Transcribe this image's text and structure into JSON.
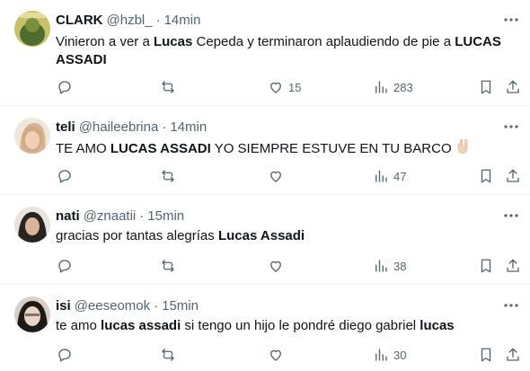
{
  "tweets": [
    {
      "name": "CLARK",
      "handle": "@hzbl_",
      "dot": "·",
      "time": "14min",
      "text": [
        {
          "t": "Vinieron a ver a "
        },
        {
          "t": "Lucas",
          "b": true
        },
        {
          "t": " Cepeda y terminaron aplaudiendo de pie a "
        },
        {
          "t": "LUCAS ASSADI",
          "b": true
        }
      ],
      "likes": "15",
      "views": "283"
    },
    {
      "name": "teli",
      "handle": "@haileebrina",
      "dot": "·",
      "time": "14min",
      "text": [
        {
          "t": "TE AMO "
        },
        {
          "t": "LUCAS ASSADI",
          "b": true
        },
        {
          "t": " YO SIEMPRE ESTUVE EN TU BARCO "
        }
      ],
      "emoji": "rock-hand-emoji",
      "likes": "",
      "views": "47"
    },
    {
      "name": "nati",
      "handle": "@znaatii",
      "dot": "·",
      "time": "15min",
      "text": [
        {
          "t": "gracias por tantas alegrías "
        },
        {
          "t": "Lucas Assadi",
          "b": true
        }
      ],
      "likes": "",
      "views": "38"
    },
    {
      "name": "isi",
      "handle": "@eeseomok",
      "dot": "·",
      "time": "15min",
      "text": [
        {
          "t": "te amo "
        },
        {
          "t": "lucas assadi",
          "b": true
        },
        {
          "t": " si tengo un hijo le pondré diego gabriel "
        },
        {
          "t": "lucas",
          "b": true
        }
      ],
      "likes": "",
      "views": "30"
    }
  ],
  "colors": {
    "text": "#0f1419",
    "secondary": "#536471",
    "border": "#eff3f4"
  },
  "icons": [
    "reply-icon",
    "retweet-icon",
    "like-icon",
    "views-icon",
    "bookmark-icon",
    "share-icon",
    "more-icon"
  ]
}
